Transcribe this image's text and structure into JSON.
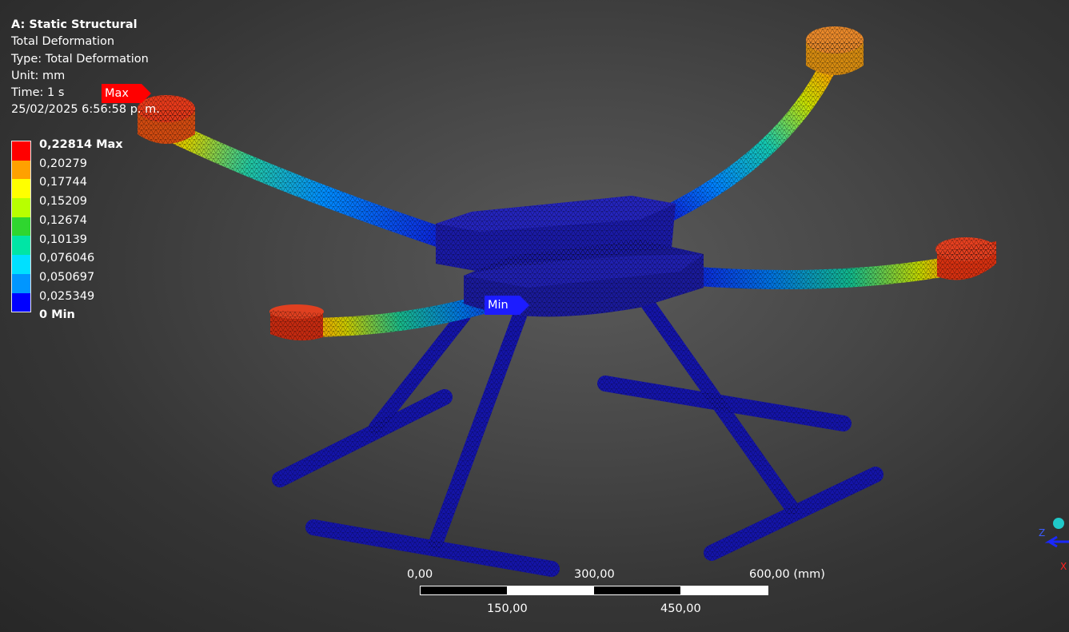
{
  "info": {
    "analysis": "A: Static Structural",
    "result": "Total Deformation",
    "type": "Type: Total Deformation",
    "unit": "Unit: mm",
    "time": "Time: 1 s",
    "datetime": "25/02/2025 6:56:58 p. m."
  },
  "legend": {
    "labels": [
      "0,22814 Max",
      "0,20279",
      "0,17744",
      "0,15209",
      "0,12674",
      "0,10139",
      "0,076046",
      "0,050697",
      "0,025349",
      "0 Min"
    ],
    "colors": [
      "#ff0000",
      "#ffa100",
      "#ffff00",
      "#b8ff00",
      "#2fd62f",
      "#00e5a5",
      "#00e0ff",
      "#0096ff",
      "#0000ff"
    ]
  },
  "probes": {
    "max": "Max",
    "min": "Min"
  },
  "scale": {
    "top": [
      "0,00",
      "300,00",
      "600,00 (mm)"
    ],
    "bottom": [
      "150,00",
      "450,00"
    ]
  },
  "triad": {
    "z": "Z",
    "x": "X"
  }
}
